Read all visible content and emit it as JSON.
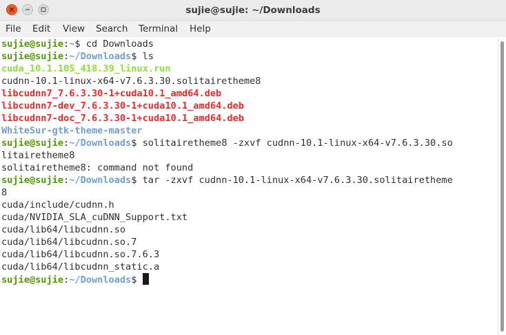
{
  "window": {
    "title": "sujie@sujie: ~/Downloads"
  },
  "menu": [
    "File",
    "Edit",
    "View",
    "Search",
    "Terminal",
    "Help"
  ],
  "prompt": {
    "userhost": "sujie@sujie",
    "sep": ":",
    "home": "~",
    "downloads": "~/Downloads",
    "sign": "$"
  },
  "terminal": {
    "cmd1": " cd Downloads",
    "cmd2": " ls",
    "ls_run": "cuda_10.1.105_418.39_linux.run",
    "ls_tar": "cudnn-10.1-linux-x64-v7.6.3.30.solitairetheme8",
    "ls_deb1": "libcudnn7_7.6.3.30-1+cuda10.1_amd64.deb",
    "ls_deb2": "libcudnn7-dev_7.6.3.30-1+cuda10.1_amd64.deb",
    "ls_deb3": "libcudnn7-doc_7.6.3.30-1+cuda10.1_amd64.deb",
    "ls_dir": "WhiteSur-gtk-theme-master",
    "cmd3": " solitairetheme8 -zxvf cudnn-10.1-linux-x64-v7.6.3.30.so",
    "cmd3_wrap": "litairetheme8",
    "err": "solitairetheme8: command not found",
    "cmd4": " tar -zxvf cudnn-10.1-linux-x64-v7.6.3.30.solitairetheme",
    "cmd4_wrap": "8",
    "out1": "cuda/include/cudnn.h",
    "out2": "cuda/NVIDIA_SLA_cuDNN_Support.txt",
    "out3": "cuda/lib64/libcudnn.so",
    "out4": "cuda/lib64/libcudnn.so.7",
    "out5": "cuda/lib64/libcudnn.so.7.6.3",
    "out6": "cuda/lib64/libcudnn_static.a",
    "cmd5": " "
  },
  "colors": {
    "prompt_user": "#4e9a06",
    "prompt_path": "#729fcf",
    "executable": "#8ae234",
    "archive": "#ef2929",
    "directory": "#729fcf"
  }
}
